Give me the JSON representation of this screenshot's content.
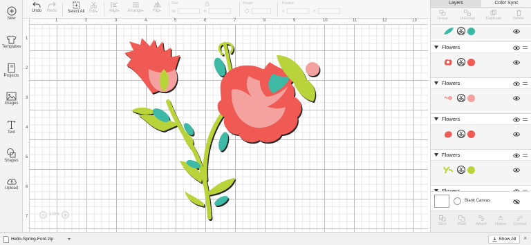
{
  "sidebar": {
    "items": [
      {
        "label": "New",
        "icon": "plus-circle-icon"
      },
      {
        "label": "Templates",
        "icon": "shirt-icon"
      },
      {
        "label": "Projects",
        "icon": "notebook-icon"
      },
      {
        "label": "Images",
        "icon": "image-icon"
      },
      {
        "label": "Text",
        "icon": "text-t-icon"
      },
      {
        "label": "Shapes",
        "icon": "shapes-icon"
      },
      {
        "label": "Upload",
        "icon": "cloud-upload-icon"
      }
    ]
  },
  "toolbar": {
    "undo": "Undo",
    "redo": "Redo",
    "select_all": "Select All",
    "edit": "Edit",
    "align": "Align",
    "arrange": "Arrange",
    "flip": "Flip",
    "size_label": "Size",
    "w_label": "W",
    "h_label": "H",
    "rotate_label": "Rotate",
    "position_label": "Position",
    "x_label": "X",
    "y_label": "Y"
  },
  "rulers": {
    "top": [
      "1",
      "2",
      "3",
      "4",
      "5",
      "6",
      "7",
      "8",
      "9",
      "10",
      "11",
      "12",
      "13"
    ],
    "left": [
      "1",
      "2",
      "3",
      "4",
      "5",
      "6",
      "7"
    ]
  },
  "canvas": {
    "zoom_level": "100%",
    "zoom_minus": "−",
    "zoom_plus": "+"
  },
  "panel": {
    "tabs": [
      "Layers",
      "Color Sync"
    ],
    "actions": [
      "Group",
      "UnGroup",
      "Duplicate",
      "Delete"
    ],
    "groups": [
      {
        "name": "Flowers",
        "colors": [
          "#ef5a54",
          "#ef5a54"
        ]
      },
      {
        "name": "Flowers",
        "colors": [
          "#f4a2a0",
          "#f4a2a0"
        ]
      },
      {
        "name": "Flowers",
        "colors": [
          "#ef5a54",
          "#ef5a54"
        ]
      },
      {
        "name": "Flowers",
        "colors": [
          "#b9d43a",
          "#b9d43a"
        ]
      },
      {
        "name": "Flowers",
        "colors": []
      }
    ],
    "top_layer_colors": [
      "#3cb9a5",
      "#3cb9a5"
    ],
    "blank_canvas": "Blank Canvas",
    "bottom_actions": [
      "Slice",
      "Weld",
      "Attach",
      "Flatten",
      "Contour"
    ]
  },
  "download_bar": {
    "file_name": "Hello-Spring-Font.zip",
    "show_all": "Show All",
    "close": "×"
  },
  "colors": {
    "coral": "#ef5a54",
    "pink": "#f4a2a0",
    "lime": "#b9d43a",
    "teal": "#3cb9a5"
  }
}
